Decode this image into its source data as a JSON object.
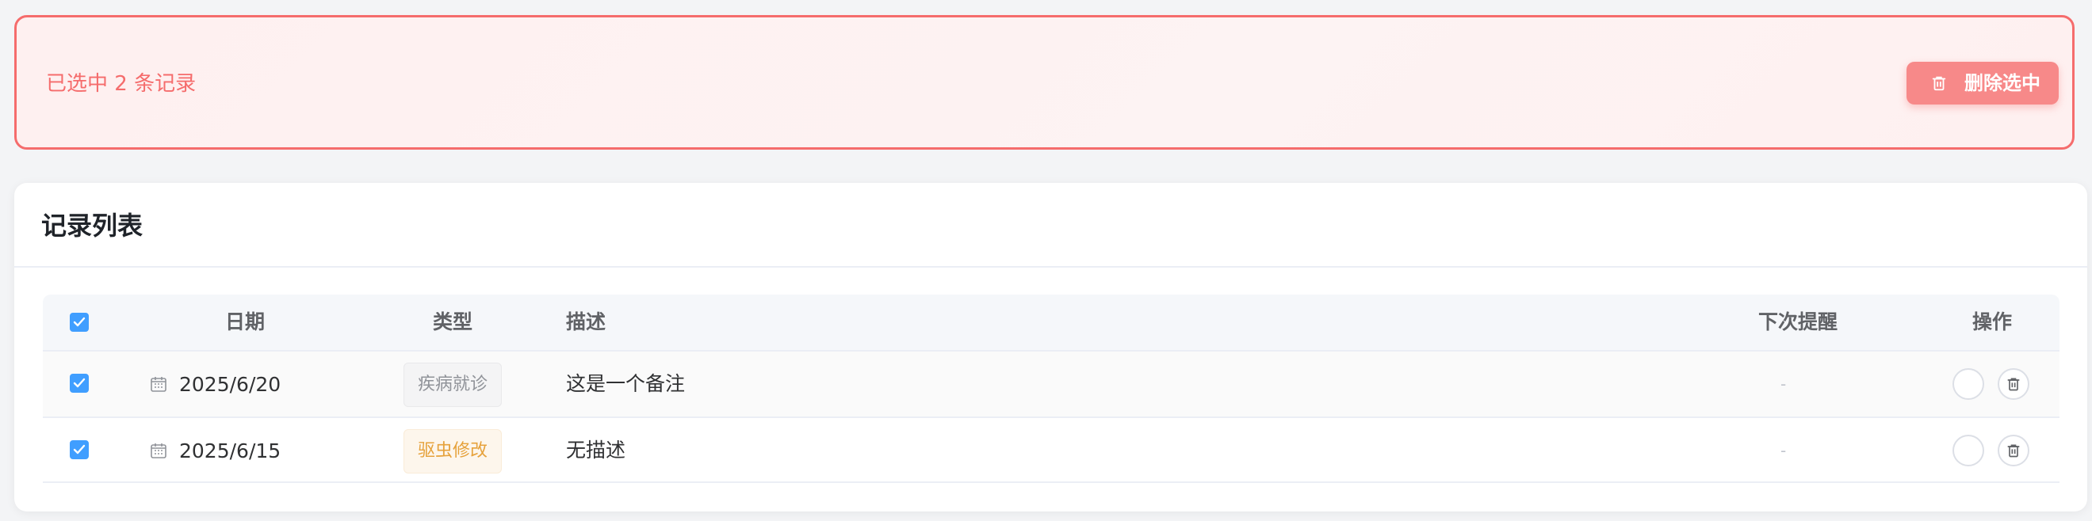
{
  "banner": {
    "selected_text": "已选中 2 条记录",
    "delete_selected_label": "删除选中"
  },
  "card": {
    "title": "记录列表"
  },
  "table": {
    "headers": {
      "date": "日期",
      "type": "类型",
      "description": "描述",
      "next_reminder": "下次提醒",
      "actions": "操作"
    },
    "header_checked": true,
    "rows": [
      {
        "checked": true,
        "date": "2025/6/20",
        "type": "疾病就诊",
        "type_color": "gray",
        "description": "这是一个备注",
        "next_reminder": "-"
      },
      {
        "checked": true,
        "date": "2025/6/15",
        "type": "驱虫修改",
        "type_color": "orange",
        "description": "无描述",
        "next_reminder": "-"
      }
    ]
  },
  "colors": {
    "danger": "#f56c6c",
    "primary": "#409eff",
    "warning": "#e6a23c"
  },
  "icons": {
    "delete_selected": "trash-icon",
    "date": "calendar-icon",
    "row_delete": "trash-icon",
    "checkbox": "checkmark-icon"
  }
}
